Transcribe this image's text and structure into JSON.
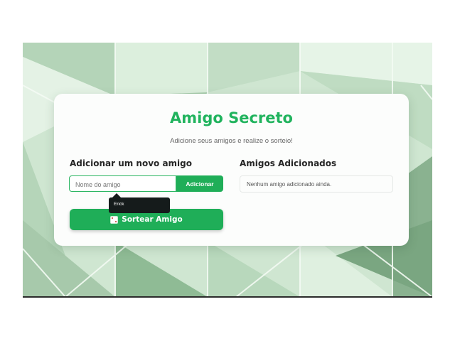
{
  "header": {
    "title": "Amigo Secreto",
    "subtitle": "Adicione seus amigos e realize o sorteio!"
  },
  "add_section": {
    "heading": "Adicionar um novo amigo",
    "input_placeholder": "Nome do amigo",
    "input_value": "",
    "add_button_label": "Adicionar",
    "draw_button_label": "Sortear Amigo",
    "draw_button_icon": "dice-icon"
  },
  "friends_section": {
    "heading": "Amigos Adicionados",
    "empty_message": "Nenhum amigo adicionado ainda."
  },
  "autocomplete": {
    "suggestion": "Erick"
  },
  "colors": {
    "accent": "#20b35d",
    "button": "#1fae58",
    "tooltip_bg": "#151b1b"
  }
}
